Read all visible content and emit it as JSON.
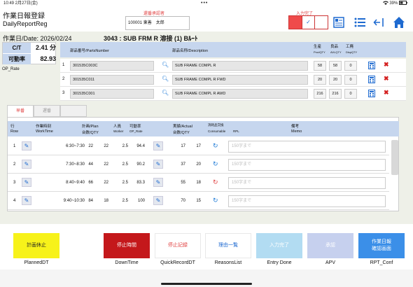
{
  "status": {
    "time": "10:49  2月27日(金)",
    "dots": "•••",
    "battery": "39%"
  },
  "header": {
    "title_jp": "作業日報登録",
    "title_en": "DailyReportReg",
    "approver_label": "還番承認者",
    "approver_value": "100001 東善　太郎",
    "entry_label": "入力完了",
    "check": "✓"
  },
  "info": {
    "date": "作業日/Date: 2026/02/24",
    "model": "3043 : SUB FRM R 溶接 (1) Bﾙｰﾄ",
    "ct_label": "C/T",
    "ct_value": "2.41 分",
    "rate_label": "可動率",
    "rate_value": "82.93",
    "op_rate": "OP_Rate"
  },
  "parts_header": {
    "part_no": "部品番号/PartsNumber",
    "part_desc": "部品名称/Description",
    "prod": "生産",
    "good": "良品",
    "defect": "工廃",
    "prod_en": "ProdQTY",
    "good_en": "AVLQTY",
    "defect_en": "DispQTY"
  },
  "parts": [
    {
      "num": "1",
      "part_no": "301535C003C",
      "desc": "SUB FRAME COMPL R",
      "prod": "58",
      "good": "58",
      "defect": "0"
    },
    {
      "num": "2",
      "part_no": "301535C011",
      "desc": "SUB FRAME COMPL R FWD",
      "prod": "20",
      "good": "20",
      "defect": "0"
    },
    {
      "num": "3",
      "part_no": "301535C001",
      "desc": "SUB FRAME COMPL R AWD",
      "prod": "216",
      "good": "216",
      "defect": "0"
    }
  ],
  "tabs": [
    {
      "label": "早番"
    },
    {
      "label": "遅番"
    },
    {
      "label": ""
    }
  ],
  "work_header": {
    "row_jp": "行",
    "row_en": "Row",
    "time_jp": "作業時刻",
    "time_en": "WorkTime",
    "plan_jp": "計画/Plan",
    "plan_en": "台数/QTY",
    "worker_jp": "人員",
    "worker_en": "Worker",
    "oprate_jp": "可動率",
    "oprate_en": "OP_Rate",
    "actual_jp": "実績/Actual",
    "actual_en": "台数/QTY",
    "consumable_jp": "消耗品交換",
    "consumable_en": "Consumable",
    "rpl": "RPL",
    "memo_jp": "備考",
    "memo_en": "Memo"
  },
  "work_rows": [
    {
      "row": "1",
      "time": "6:30~7:30",
      "plan_a": "22",
      "plan_b": "22",
      "worker": "2.5",
      "rate": "94.4",
      "act_a": "17",
      "act_b": "17",
      "memo": "150字まで",
      "swap_color": "#1e7ad6"
    },
    {
      "row": "2",
      "time": "7:30~8:30",
      "plan_a": "44",
      "plan_b": "22",
      "worker": "2.5",
      "rate": "90.2",
      "act_a": "37",
      "act_b": "20",
      "memo": "150字まで",
      "swap_color": "#1e7ad6"
    },
    {
      "row": "3",
      "time": "8:40~9:40",
      "plan_a": "66",
      "plan_b": "22",
      "worker": "2.5",
      "rate": "83.3",
      "act_a": "55",
      "act_b": "18",
      "memo": "150字まで",
      "swap_color": "#e04040"
    },
    {
      "row": "4",
      "time": "9:40~10:30",
      "plan_a": "84",
      "plan_b": "18",
      "worker": "2.5",
      "rate": "100",
      "act_a": "70",
      "act_b": "15",
      "memo": "150字まで",
      "swap_color": "#1e7ad6"
    }
  ],
  "buttons": [
    {
      "label": "計画休止",
      "sub": "PlannedDT",
      "bg": "#f7f21a",
      "fg": "#222222"
    },
    {
      "label": "停止時間",
      "sub": "DownTime",
      "bg": "#c4181b",
      "fg": "#ffffff"
    },
    {
      "label": "停止記録",
      "sub": "QuickRecordDT",
      "bg": "#ffffff",
      "fg": "#e04040"
    },
    {
      "label": "理由一覧",
      "sub": "ReasonsList",
      "bg": "#ffffff",
      "fg": "#1e6ad0"
    },
    {
      "label": "入力完了",
      "sub": "Entry Done",
      "bg": "#b2dcf2",
      "fg": "#ffffff"
    },
    {
      "label": "承認",
      "sub": "APV",
      "bg": "#c6d0ee",
      "fg": "#ffffff"
    },
    {
      "label": "作業日報\n確認画面",
      "sub": "RPT_Conf",
      "bg": "#3b8fe8",
      "fg": "#ffffff"
    }
  ],
  "colors": {
    "accent": "#1e6ad0",
    "header_band": "#c6d6ee",
    "main_bg": "#eef0e8",
    "alert": "#e04040"
  },
  "icons": [
    "wifi-icon",
    "battery-icon",
    "list-view-icon",
    "menu-icon",
    "logout-icon",
    "home-icon",
    "search-icon",
    "calculator-icon",
    "delete-icon",
    "edit-icon",
    "swap-icon"
  ]
}
